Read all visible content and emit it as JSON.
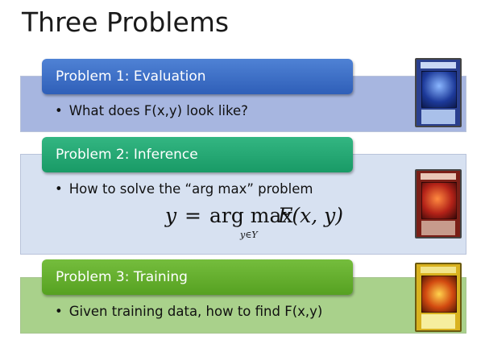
{
  "slide": {
    "title": "Three Problems",
    "problems": [
      {
        "header": "Problem 1: Evaluation",
        "bullet": "What does F(x,y) look like?"
      },
      {
        "header": "Problem 2: Inference",
        "bullet": "How to solve the “arg max” problem"
      },
      {
        "header": "Problem 3: Training",
        "bullet": "Given training data, how to find F(x,y)"
      }
    ],
    "formula": {
      "lhs": "y",
      "eq": "=",
      "op": "arg max",
      "subscript": "y∈Y",
      "fn": "F(x, y)"
    },
    "bullet_symbol": "•",
    "colors": {
      "problem1": "#3a6cc7",
      "problem2": "#23a874",
      "problem3": "#63ad2c"
    }
  }
}
